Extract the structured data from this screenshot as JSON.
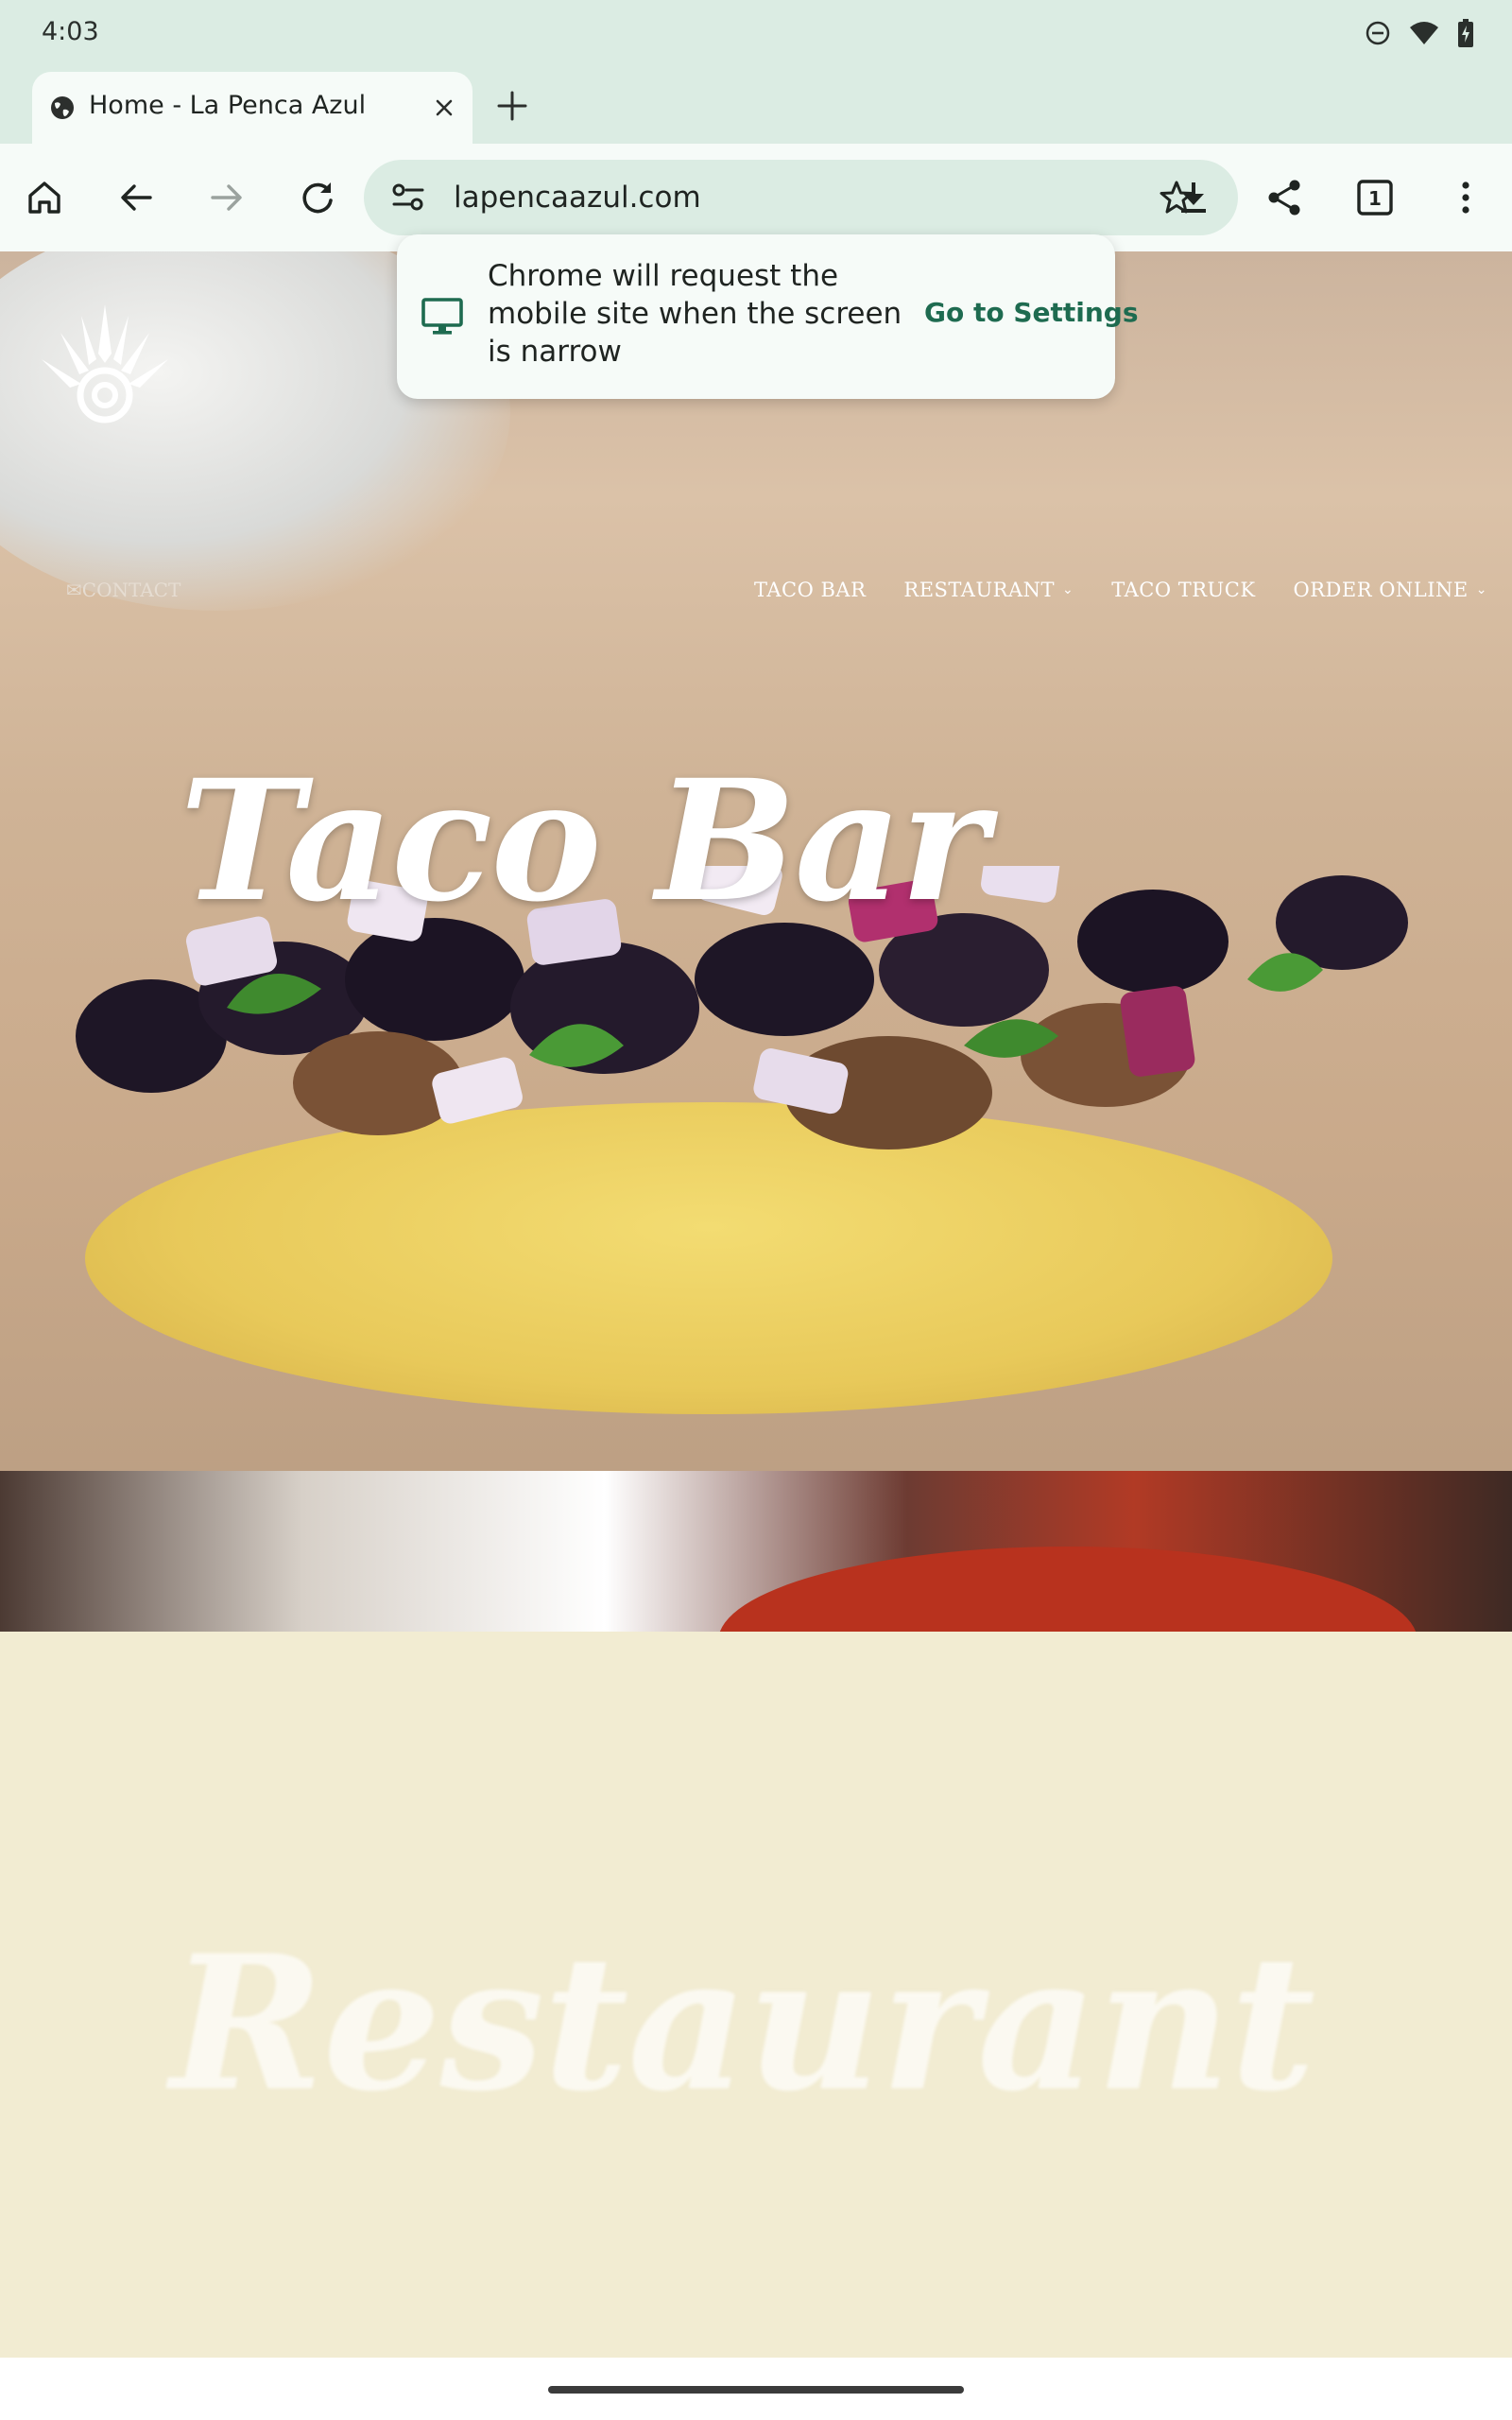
{
  "status_bar": {
    "time": "4:03",
    "icons": [
      "do-not-disturb-icon",
      "wifi-icon",
      "battery-icon"
    ]
  },
  "tab": {
    "title": "Home - La Penca Azul",
    "favicon": "globe-icon"
  },
  "toolbar": {
    "url": "lapencaazul.com",
    "tab_count": "1",
    "icons": [
      "home-icon",
      "back-icon",
      "forward-icon",
      "reload-icon",
      "site-settings-icon",
      "bookmark-star-icon",
      "download-icon",
      "share-icon",
      "tab-switcher-icon",
      "menu-icon"
    ]
  },
  "popup": {
    "message": "Chrome will request the mobile site when the screen is narrow",
    "action": "Go to Settings",
    "icon": "desktop-monitor-icon"
  },
  "site": {
    "nav": {
      "contact": "CONTACT",
      "items": [
        {
          "label": "TACO BAR",
          "has_dropdown": false
        },
        {
          "label": "RESTAURANT",
          "has_dropdown": true
        },
        {
          "label": "TACO TRUCK",
          "has_dropdown": false
        },
        {
          "label": "ORDER ONLINE",
          "has_dropdown": true
        }
      ]
    },
    "hero_title": "Taco Bar",
    "section_title": "Restaurant"
  },
  "colors": {
    "chrome_bg": "#dbece3",
    "toolbar_bg": "#f6fbf8",
    "accent_green": "#1e6b50",
    "restaurant_bg": "#f2ecd2"
  }
}
